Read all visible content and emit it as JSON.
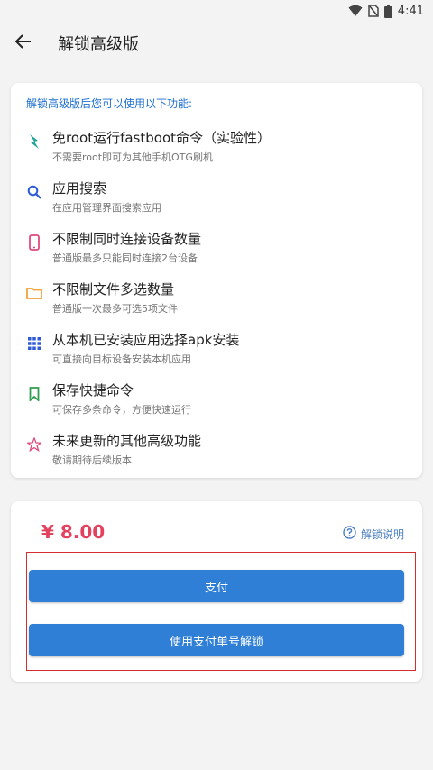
{
  "status_bar": {
    "time": "4:41"
  },
  "app_bar": {
    "title": "解锁高级版"
  },
  "features": {
    "header": "解锁高级版后您可以使用以下功能:",
    "items": [
      {
        "icon": "lightning-icon",
        "title": "免root运行fastboot命令（实验性）",
        "desc": "不需要root即可为其他手机OTG刷机"
      },
      {
        "icon": "search-icon",
        "title": "应用搜索",
        "desc": "在应用管理界面搜索应用"
      },
      {
        "icon": "phone-icon",
        "title": "不限制同时连接设备数量",
        "desc": "普通版最多只能同时连接2台设备"
      },
      {
        "icon": "folder-icon",
        "title": "不限制文件多选数量",
        "desc": "普通版一次最多可选5项文件"
      },
      {
        "icon": "grid-icon",
        "title": "从本机已安装应用选择apk安装",
        "desc": "可直接向目标设备安装本机应用"
      },
      {
        "icon": "bookmark-icon",
        "title": "保存快捷命令",
        "desc": "可保存多条命令，方便快速运行"
      },
      {
        "icon": "star-icon",
        "title": "未来更新的其他高级功能",
        "desc": "敬请期待后续版本"
      }
    ]
  },
  "payment": {
    "price": "¥ 8.00",
    "help_label": "解锁说明",
    "pay_label": "支付",
    "unlock_label": "使用支付单号解锁"
  },
  "colors": {
    "accent": "#2f7fd6",
    "price": "#e3415e",
    "highlight": "#d32f2f"
  }
}
